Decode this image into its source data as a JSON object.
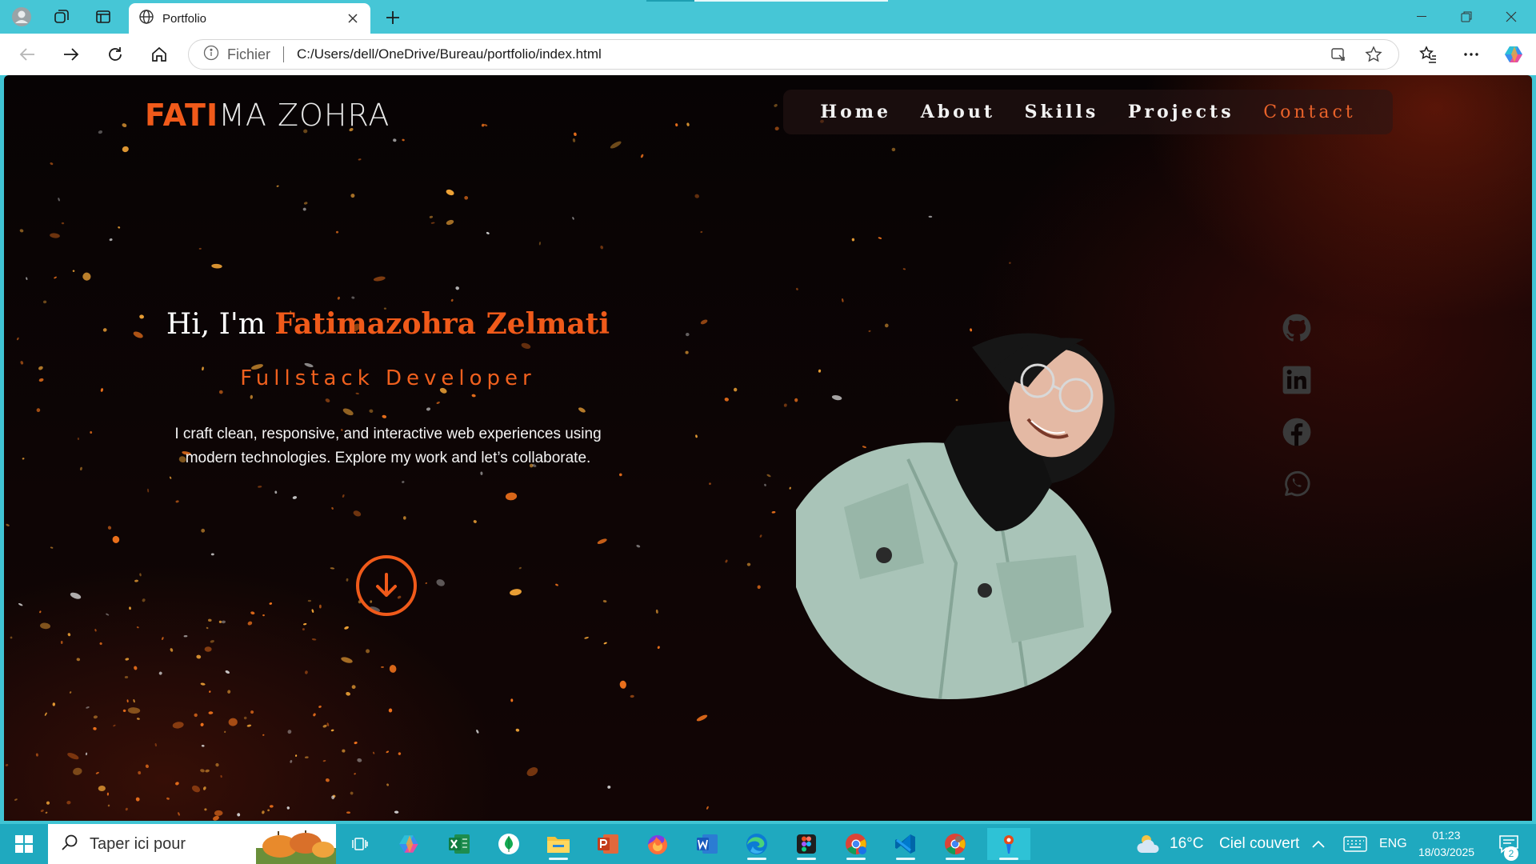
{
  "browser": {
    "tab_title": "Portfolio",
    "address_scheme": "Fichier",
    "address_url": "C:/Users/dell/OneDrive/Bureau/portfolio/index.html"
  },
  "site": {
    "logo_accent": "FATI",
    "logo_rest": "MA ZOHRA",
    "menu": [
      "Home",
      "About",
      "Skills",
      "Projects",
      "Contact"
    ],
    "active_menu": "Contact",
    "greeting": "Hi, I'm",
    "name": "Fatimazohra Zelmati",
    "role": "Fullstack Developer",
    "description": "I craft clean, responsive, and interactive web experiences using modern technologies. Explore my work and let’s collaborate.",
    "socials": [
      "github-icon",
      "linkedin-icon",
      "facebook-icon",
      "whatsapp-icon"
    ],
    "accent_color": "#f05a1a"
  },
  "taskbar": {
    "search_placeholder": "Taper ici pour",
    "weather_temp": "16°C",
    "weather_text": "Ciel couvert",
    "language": "ENG",
    "time": "01:23",
    "date": "18/03/2025",
    "notification_count": "2",
    "pinned_apps": [
      "task-view",
      "copilot",
      "excel",
      "mongodb",
      "file-explorer",
      "powerpoint",
      "firefox",
      "word",
      "edge",
      "figma",
      "chrome-profile",
      "vscode",
      "chrome",
      "app-active"
    ]
  }
}
